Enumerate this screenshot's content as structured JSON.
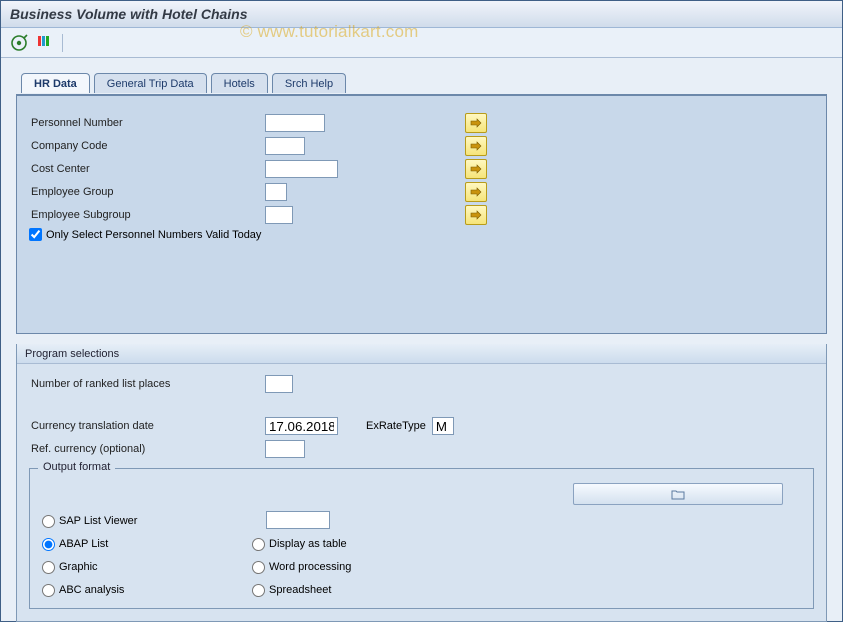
{
  "title": "Business Volume with Hotel Chains",
  "watermark": "© www.tutorialkart.com",
  "tabs": {
    "hr_data": "HR Data",
    "general_trip": "General Trip Data",
    "hotels": "Hotels",
    "srch_help": "Srch Help"
  },
  "hr": {
    "personnel_number": {
      "label": "Personnel Number",
      "value": ""
    },
    "company_code": {
      "label": "Company Code",
      "value": ""
    },
    "cost_center": {
      "label": "Cost Center",
      "value": ""
    },
    "employee_group": {
      "label": "Employee Group",
      "value": ""
    },
    "employee_subgroup": {
      "label": "Employee Subgroup",
      "value": ""
    },
    "only_valid_today": {
      "label": "Only Select Personnel Numbers Valid Today",
      "checked": true
    }
  },
  "program": {
    "title": "Program selections",
    "ranked_places": {
      "label": "Number of ranked list places",
      "value": ""
    },
    "currency_date": {
      "label": "Currency translation date",
      "value": "17.06.2018"
    },
    "ex_rate_type": {
      "label": "ExRateType",
      "value": "M"
    },
    "ref_currency": {
      "label": "Ref. currency (optional)",
      "value": ""
    }
  },
  "output_format": {
    "title": "Output format",
    "options": {
      "sap_list_viewer": "SAP List Viewer",
      "abap_list": "ABAP List",
      "graphic": "Graphic",
      "abc_analysis": "ABC analysis",
      "display_as_table": "Display as table",
      "word_processing": "Word processing",
      "spreadsheet": "Spreadsheet"
    },
    "selected": "abap_list",
    "sap_list_viewer_value": ""
  }
}
